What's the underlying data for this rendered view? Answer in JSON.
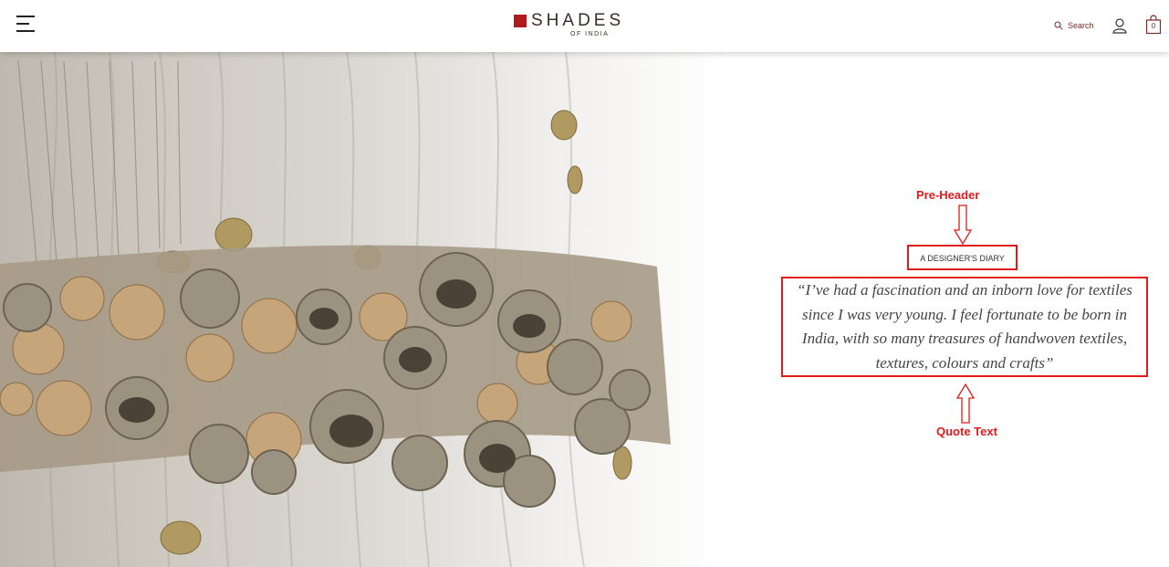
{
  "header": {
    "logo_main": "SHADES",
    "logo_sub": "OF INDIA",
    "search_label": "Search",
    "bag_count": "0",
    "brand_color": "#b0191e"
  },
  "hero": {
    "pre_header": "A DESIGNER'S DIARY",
    "quote": "“I’ve had a fascination and an inborn love for textiles since I was very young. I feel fortunate to be born in India, with so many treasures of handwoven textiles, textures, colours and crafts”"
  },
  "annotations": {
    "pre_header_label": "Pre-Header",
    "quote_label": "Quote Text",
    "color": "#e01b1b"
  }
}
